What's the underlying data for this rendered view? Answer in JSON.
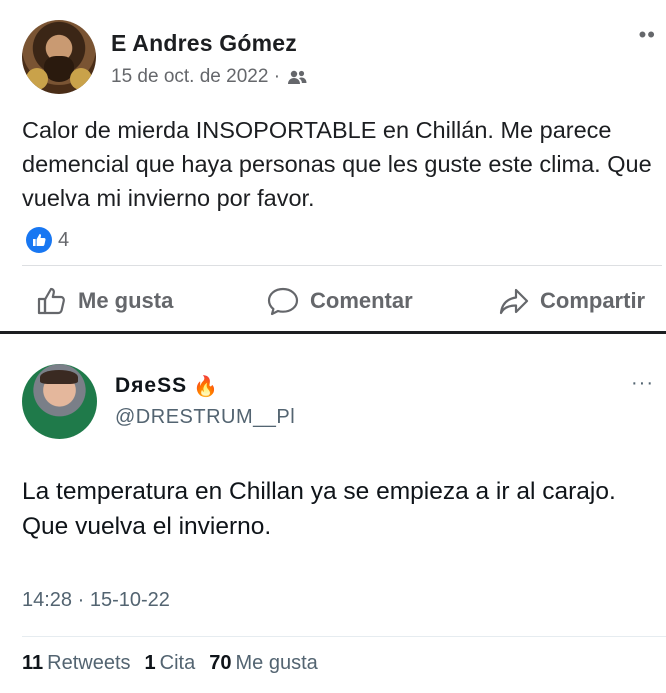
{
  "facebook_post": {
    "author": "E Andres Gómez",
    "date": "15 de oct. de 2022 ·",
    "audience_icon": "friends-icon",
    "more_icon": "••",
    "text": "Calor de mierda INSOPORTABLE en Chillán. Me parece demencial que haya personas que les guste este clima. Que vuelva mi invierno por favor.",
    "reactions_count": "4",
    "actions": {
      "like": "Me gusta",
      "comment": "Comentar",
      "share": "Compartir"
    },
    "colors": {
      "like_blue": "#1877f2",
      "secondary": "#65676b"
    }
  },
  "tweet": {
    "name": "DяeSS",
    "name_emoji": "🔥",
    "handle": "@DRESTRUM__Pl",
    "more_icon": "···",
    "text": "La temperatura en Chillan ya se empieza a ir al carajo. Que vuelva el invierno.",
    "timestamp": "14:28 · 15-10-22",
    "stats": {
      "retweets_count": "11",
      "retweets_label": "Retweets",
      "quotes_count": "1",
      "quotes_label": "Cita",
      "likes_count": "70",
      "likes_label": "Me gusta"
    }
  }
}
